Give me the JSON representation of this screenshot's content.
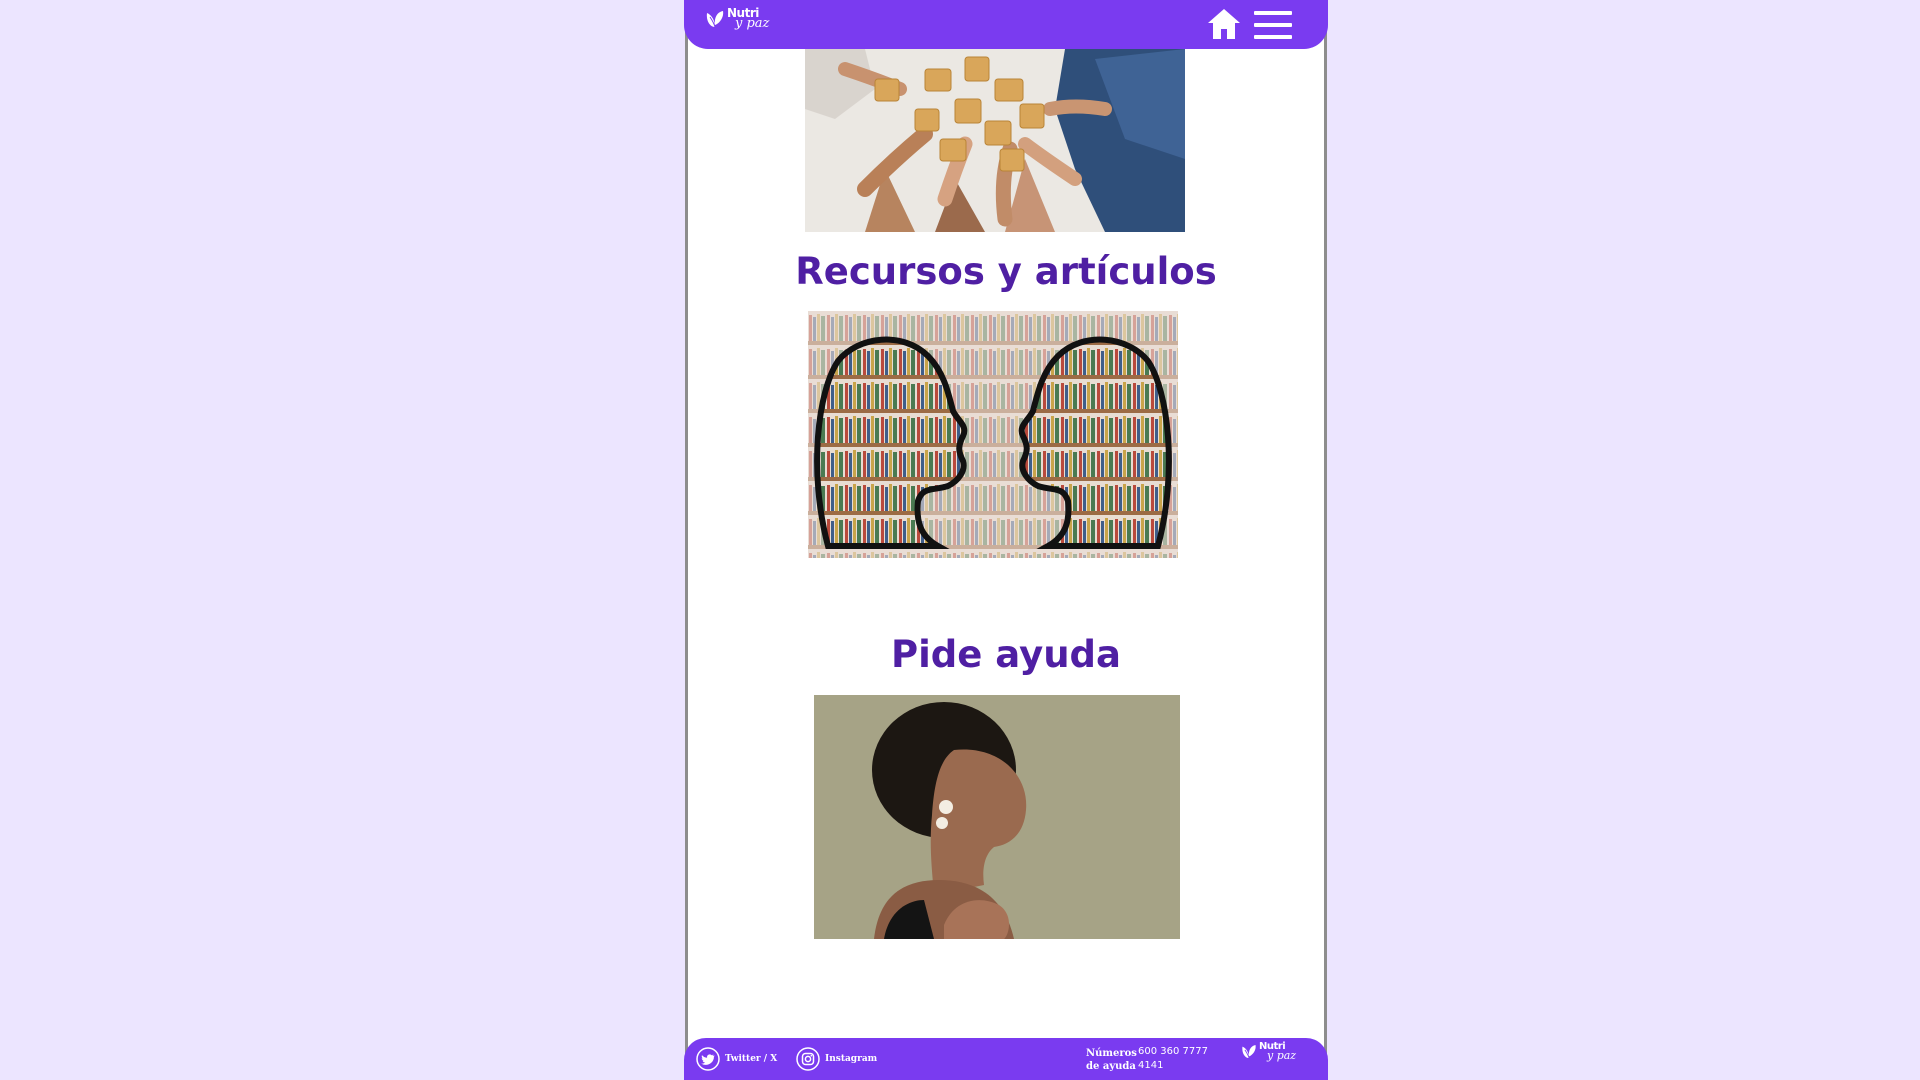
{
  "header": {
    "logo": {
      "line1": "Nutri",
      "line2": "y paz"
    },
    "home_icon": "home-icon",
    "menu_icon": "hamburger-menu-icon"
  },
  "sections": [
    {
      "title": "Recursos y artículos",
      "image": "library-heads-image"
    },
    {
      "title": "Pide ayuda",
      "image": "woman-breathing-image"
    }
  ],
  "top_image": "puzzle-hands-image",
  "footer": {
    "twitter_label": "Twitter / X",
    "instagram_label": "Instagram",
    "help_label_line1": "Números",
    "help_label_line2": "de ayuda",
    "help_number_1": "600 360 7777",
    "help_number_2": "4141",
    "logo": {
      "line1": "Nutri",
      "line2": "y paz"
    }
  },
  "colors": {
    "brand_purple": "#7a3bf0",
    "heading_purple": "#4f1fa3",
    "background_lavender": "#ece5ff"
  }
}
